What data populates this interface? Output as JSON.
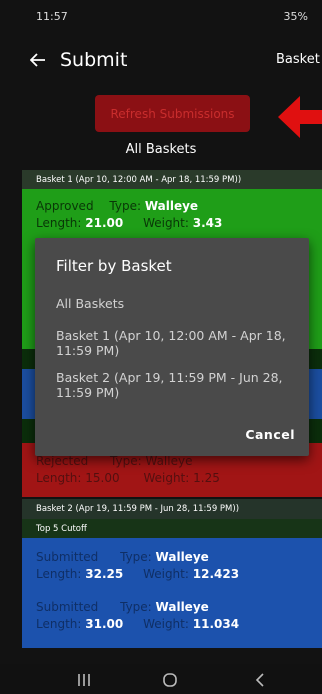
{
  "status_bar": {
    "time": "11:57",
    "battery": "35%"
  },
  "app_bar": {
    "title": "Submit",
    "action_label": "Basket"
  },
  "refresh_button": {
    "label": "Refresh Submissions"
  },
  "filter_label": "All Baskets",
  "basket1_header": "Basket 1 (Apr 10, 12:00 AM - Apr 18, 11:59 PM))",
  "approved_card": {
    "status": "Approved",
    "type_label": "Type:",
    "type_value": "Walleye",
    "length_label": "Length:",
    "length_value": "21.00",
    "weight_label": "Weight:",
    "weight_value": "3.43"
  },
  "rejected_card": {
    "status": "Rejected",
    "type_label": "Type:",
    "type_value": "Walleye",
    "length_label": "Length:",
    "length_value": "15.00",
    "weight_label": "Weight:",
    "weight_value": "1.25"
  },
  "basket2_header": "Basket 2 (Apr 19, 11:59 PM - Jun 28, 11:59 PM))",
  "cutoff_header": "Top 5 Cutoff",
  "submitted_cards": [
    {
      "status": "Submitted",
      "type_label": "Type:",
      "type_value": "Walleye",
      "length_label": "Length:",
      "length_value": "32.25",
      "weight_label": "Weight:",
      "weight_value": "12.423"
    },
    {
      "status": "Submitted",
      "type_label": "Type:",
      "type_value": "Walleye",
      "length_label": "Length:",
      "length_value": "31.00",
      "weight_label": "Weight:",
      "weight_value": "11.034"
    }
  ],
  "dialog": {
    "title": "Filter by Basket",
    "options": [
      "All Baskets",
      "Basket 1 (Apr 10, 12:00 AM - Apr 18, 11:59 PM)",
      "Basket 2 (Apr 19, 11:59 PM - Jun 28, 11:59 PM)"
    ],
    "cancel_label": "Cancel"
  },
  "colors": {
    "approved": "#1f9e18",
    "rejected": "#a11515",
    "submitted": "#1c52ad",
    "refresh": "#8b1014"
  }
}
